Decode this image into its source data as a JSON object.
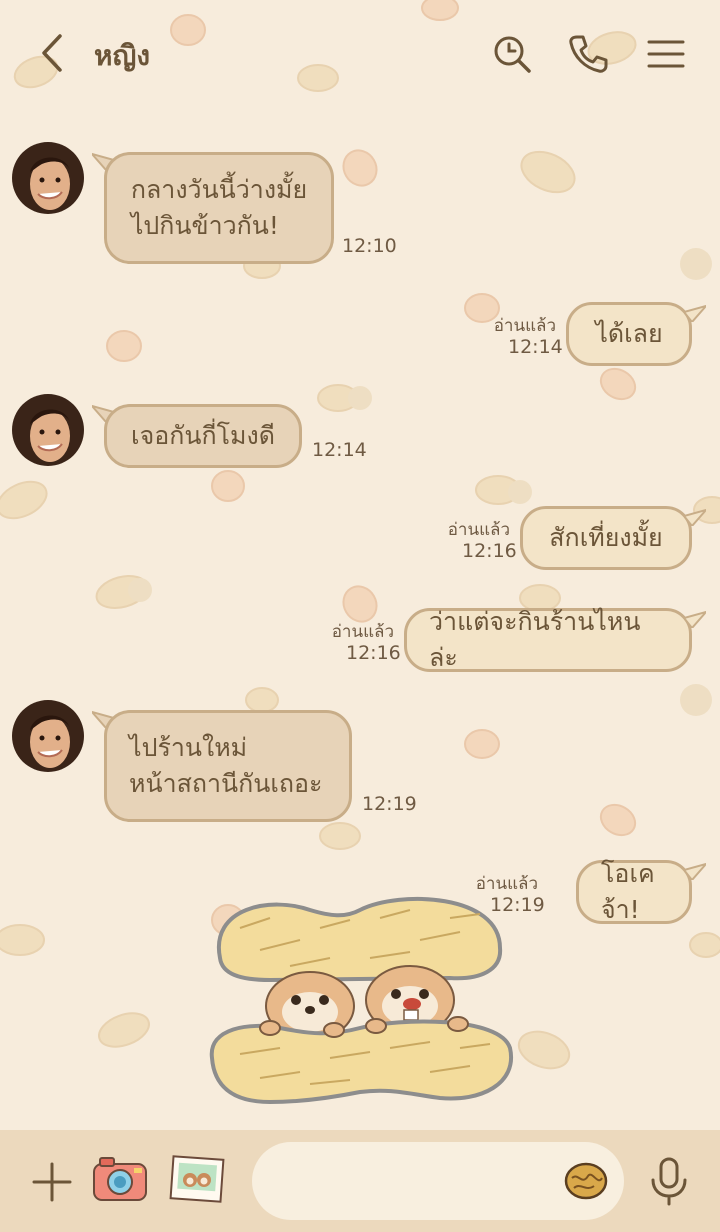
{
  "header": {
    "title": "หญิง",
    "icons": [
      "back-chevron-icon",
      "search-icon",
      "phone-icon",
      "menu-icon"
    ]
  },
  "messages": [
    {
      "from": "contact",
      "text": "กลางวันนี้ว่างมั้ย\nไปกินข้าวกัน!",
      "time": "12:10"
    },
    {
      "from": "me",
      "text": "ได้เลย",
      "read": "อ่านแล้ว",
      "time": "12:14"
    },
    {
      "from": "contact",
      "text": "เจอกันกี่โมงดี",
      "time": "12:14"
    },
    {
      "from": "me",
      "text": "สักเที่ยงมั้ย",
      "read": "อ่านแล้ว",
      "time": "12:16"
    },
    {
      "from": "me",
      "text": "ว่าแต่จะกินร้านไหนล่ะ",
      "read": "อ่านแล้ว",
      "time": "12:16"
    },
    {
      "from": "contact",
      "text": "ไปร้านใหม่\nหน้าสถานีกันเถอะ",
      "time": "12:19"
    },
    {
      "from": "me",
      "text": "โอเคจ้า!",
      "read": "อ่านแล้ว",
      "time": "12:19"
    }
  ],
  "sticker": {
    "icon": "chipmunks-in-peanut-sticker"
  },
  "footer": {
    "icons": [
      "plus-icon",
      "camera-icon",
      "photo-icon",
      "walnut-emoji-icon",
      "microphone-icon"
    ],
    "input_value": ""
  },
  "colors": {
    "background": "#f7ecdc",
    "bubble_in": "#e7d3b8",
    "bubble_out": "#f3e4c8",
    "bubble_border": "#c8ad88",
    "text": "#6b5538",
    "footer": "#ecd9bd"
  }
}
